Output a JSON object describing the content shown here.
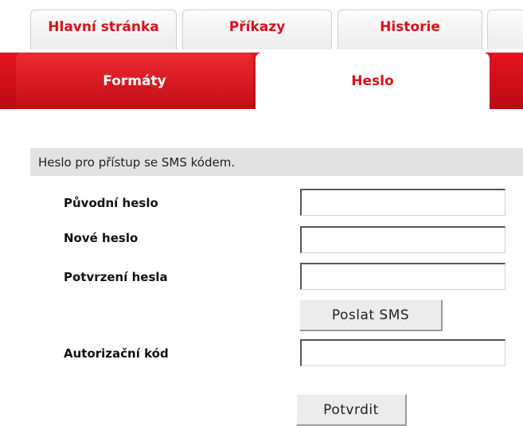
{
  "tabs_row1": [
    {
      "label": "Hlavní stránka"
    },
    {
      "label": "Příkazy"
    },
    {
      "label": "Historie"
    },
    {
      "label": ""
    }
  ],
  "tabs_row2": [
    {
      "label": "Formáty",
      "active": false
    },
    {
      "label": "Heslo",
      "active": true
    }
  ],
  "section": {
    "title": "Heslo pro přístup se SMS kódem."
  },
  "form": {
    "fields": [
      {
        "label": "Původní heslo",
        "value": ""
      },
      {
        "label": "Nové heslo",
        "value": ""
      },
      {
        "label": "Potvrzení hesla",
        "value": ""
      },
      {
        "label": "Autorizační kód",
        "value": ""
      }
    ],
    "send_sms_label": "Poslat SMS",
    "confirm_label": "Potvrdit"
  },
  "colors": {
    "brand_red": "#d8101a",
    "section_bg": "#e2e2e2"
  }
}
